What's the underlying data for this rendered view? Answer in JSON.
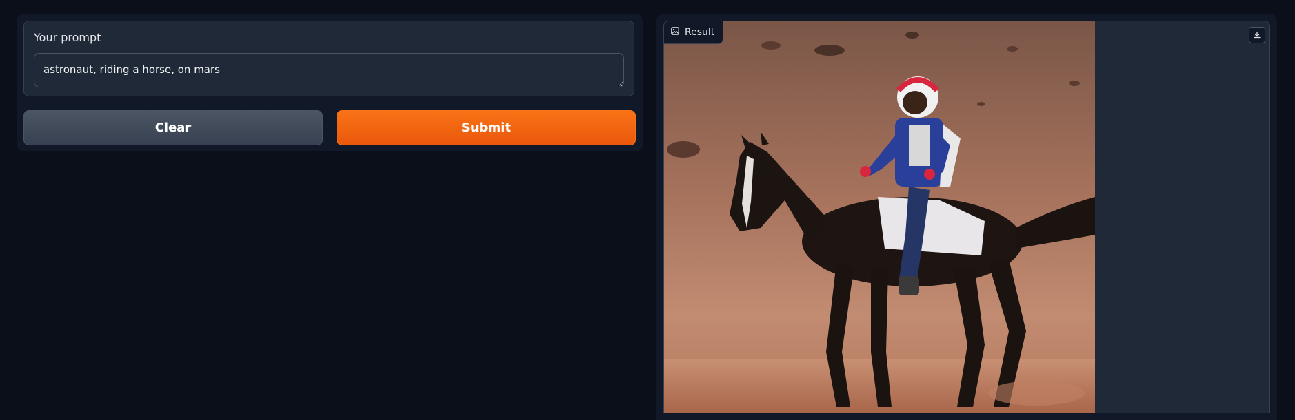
{
  "prompt": {
    "label": "Your prompt",
    "value": "astronaut, riding a horse, on mars"
  },
  "buttons": {
    "clear": "Clear",
    "submit": "Submit"
  },
  "result": {
    "label": "Result",
    "image_icon": "image-icon",
    "download_icon": "download-icon"
  },
  "colors": {
    "background": "#0b0f19",
    "panel": "#111827",
    "block": "#1f2937",
    "submit_orange": "#f97316",
    "clear_gray": "#4b5563"
  }
}
